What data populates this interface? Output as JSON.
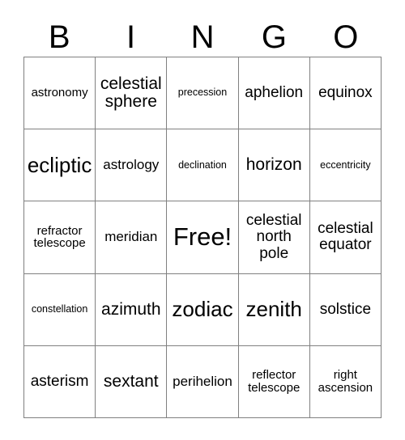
{
  "header": {
    "letters": [
      "B",
      "I",
      "N",
      "G",
      "O"
    ]
  },
  "grid": {
    "rows": [
      [
        {
          "label": "astronomy",
          "size": "fs-xs"
        },
        {
          "label": "celestial sphere",
          "size": "fs-lg"
        },
        {
          "label": "precession",
          "size": "fs-xxs"
        },
        {
          "label": "aphelion",
          "size": "fs-md"
        },
        {
          "label": "equinox",
          "size": "fs-md"
        }
      ],
      [
        {
          "label": "ecliptic",
          "size": "fs-xl"
        },
        {
          "label": "astrology",
          "size": "fs-sm"
        },
        {
          "label": "declination",
          "size": "fs-xxs"
        },
        {
          "label": "horizon",
          "size": "fs-lg"
        },
        {
          "label": "eccentricity",
          "size": "fs-xxs"
        }
      ],
      [
        {
          "label": "refractor telescope",
          "size": "fs-xs"
        },
        {
          "label": "meridian",
          "size": "fs-sm"
        },
        {
          "label": "Free!",
          "size": "fs-xxl"
        },
        {
          "label": "celestial north pole",
          "size": "fs-md"
        },
        {
          "label": "celestial equator",
          "size": "fs-md"
        }
      ],
      [
        {
          "label": "constellation",
          "size": "fs-xxs"
        },
        {
          "label": "azimuth",
          "size": "fs-lg"
        },
        {
          "label": "zodiac",
          "size": "fs-xl"
        },
        {
          "label": "zenith",
          "size": "fs-xl"
        },
        {
          "label": "solstice",
          "size": "fs-md"
        }
      ],
      [
        {
          "label": "asterism",
          "size": "fs-md"
        },
        {
          "label": "sextant",
          "size": "fs-lg"
        },
        {
          "label": "perihelion",
          "size": "fs-sm"
        },
        {
          "label": "reflector telescope",
          "size": "fs-xs"
        },
        {
          "label": "right ascension",
          "size": "fs-xs"
        }
      ]
    ]
  },
  "colors": {
    "grid_line": "#808080",
    "text": "#000000",
    "background": "#ffffff"
  }
}
